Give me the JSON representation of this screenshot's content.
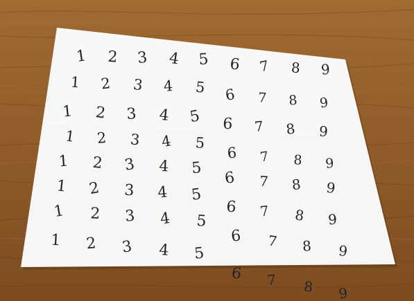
{
  "scene": {
    "table_color": "#9a6530",
    "table_dark": "#6e4219",
    "paper_color": "#f6f6f4",
    "ink_color": "#1d2430"
  },
  "digit_rows": [
    [
      "1",
      "2",
      "3",
      "4",
      "5",
      "6",
      "7",
      "8",
      "9"
    ],
    [
      "1",
      "2",
      "3",
      "4",
      "5",
      "6",
      "7",
      "8",
      "9"
    ],
    [
      "1",
      "2",
      "3",
      "4",
      "5",
      "6",
      "7",
      "8",
      "9"
    ],
    [
      "1",
      "2",
      "3",
      "4",
      "5",
      "6",
      "7",
      "8",
      "9"
    ],
    [
      "1",
      "2",
      "3",
      "4",
      "5",
      "6",
      "7",
      "8",
      "9"
    ],
    [
      "1",
      "2",
      "3",
      "4",
      "5",
      "6",
      "7",
      "8",
      "9"
    ],
    [
      "1",
      "2",
      "3",
      "4",
      "5",
      "6",
      "7",
      "8",
      "9"
    ],
    [
      "1",
      "2",
      "3",
      "4",
      "5",
      "6",
      "7",
      "8",
      "9"
    ]
  ]
}
